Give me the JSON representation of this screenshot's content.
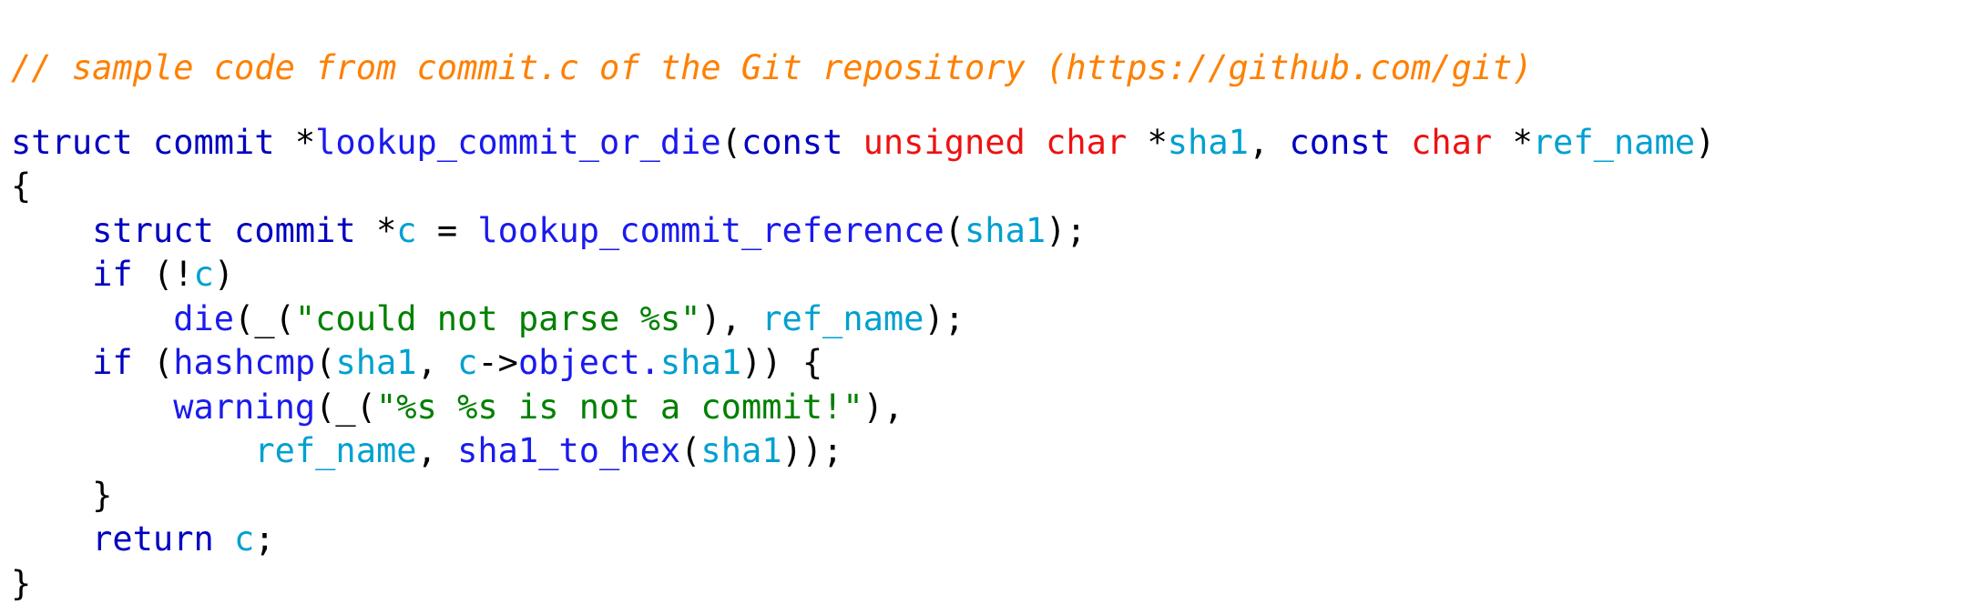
{
  "snippet": {
    "language": "C",
    "source_note": "// sample code from commit.c of the Git repository (https://github.com/git)",
    "background_color": "#ffffff",
    "palette": {
      "comment": "#ff8000",
      "keyword": "#0000c0",
      "type": "#ee1111",
      "function": "#1a1aee",
      "variable": "#00a0d0",
      "string": "#008000",
      "punctuation": "#000000"
    },
    "lines": [
      {
        "id": "line-1-comment",
        "tokens": [
          {
            "t": "// sample code from commit.c of the Git repository (https://github.com/git)",
            "c": "comment"
          }
        ]
      },
      {
        "id": "line-2-blank",
        "blank": true,
        "tokens": []
      },
      {
        "id": "line-3-signature",
        "tokens": [
          {
            "t": "struct commit ",
            "c": "keyword"
          },
          {
            "t": "*",
            "c": "punct"
          },
          {
            "t": "lookup_commit_or_die",
            "c": "function"
          },
          {
            "t": "(",
            "c": "punct"
          },
          {
            "t": "const ",
            "c": "keyword"
          },
          {
            "t": "unsigned char ",
            "c": "type"
          },
          {
            "t": "*",
            "c": "punct"
          },
          {
            "t": "sha1",
            "c": "variable"
          },
          {
            "t": ", ",
            "c": "punct"
          },
          {
            "t": "const ",
            "c": "keyword"
          },
          {
            "t": "char ",
            "c": "type"
          },
          {
            "t": "*",
            "c": "punct"
          },
          {
            "t": "ref_name",
            "c": "variable"
          },
          {
            "t": ")",
            "c": "punct"
          }
        ]
      },
      {
        "id": "line-4-open-brace",
        "tokens": [
          {
            "t": "{",
            "c": "punct"
          }
        ]
      },
      {
        "id": "line-5-declaration",
        "tokens": [
          {
            "t": "    ",
            "c": "plain"
          },
          {
            "t": "struct commit ",
            "c": "keyword"
          },
          {
            "t": "*",
            "c": "punct"
          },
          {
            "t": "c",
            "c": "variable"
          },
          {
            "t": " = ",
            "c": "punct"
          },
          {
            "t": "lookup_commit_reference",
            "c": "function"
          },
          {
            "t": "(",
            "c": "punct"
          },
          {
            "t": "sha1",
            "c": "variable"
          },
          {
            "t": ");",
            "c": "punct"
          }
        ]
      },
      {
        "id": "line-6-if-null",
        "tokens": [
          {
            "t": "    ",
            "c": "plain"
          },
          {
            "t": "if",
            "c": "keyword"
          },
          {
            "t": " (!",
            "c": "punct"
          },
          {
            "t": "c",
            "c": "variable"
          },
          {
            "t": ")",
            "c": "punct"
          }
        ]
      },
      {
        "id": "line-7-die",
        "tokens": [
          {
            "t": "        ",
            "c": "plain"
          },
          {
            "t": "die",
            "c": "function"
          },
          {
            "t": "(_(",
            "c": "punct"
          },
          {
            "t": "\"could not parse %s\"",
            "c": "string"
          },
          {
            "t": "), ",
            "c": "punct"
          },
          {
            "t": "ref_name",
            "c": "variable"
          },
          {
            "t": ");",
            "c": "punct"
          }
        ]
      },
      {
        "id": "line-8-if-hashcmp",
        "tokens": [
          {
            "t": "    ",
            "c": "plain"
          },
          {
            "t": "if",
            "c": "keyword"
          },
          {
            "t": " (",
            "c": "punct"
          },
          {
            "t": "hashcmp",
            "c": "function"
          },
          {
            "t": "(",
            "c": "punct"
          },
          {
            "t": "sha1",
            "c": "variable"
          },
          {
            "t": ", ",
            "c": "punct"
          },
          {
            "t": "c",
            "c": "variable"
          },
          {
            "t": "->",
            "c": "punct"
          },
          {
            "t": "object.",
            "c": "function"
          },
          {
            "t": "sha1",
            "c": "variable"
          },
          {
            "t": ")) {",
            "c": "punct"
          }
        ]
      },
      {
        "id": "line-9-warning",
        "tokens": [
          {
            "t": "        ",
            "c": "plain"
          },
          {
            "t": "warning",
            "c": "function"
          },
          {
            "t": "(_(",
            "c": "punct"
          },
          {
            "t": "\"%s %s is not a commit!\"",
            "c": "string"
          },
          {
            "t": "),",
            "c": "punct"
          }
        ]
      },
      {
        "id": "line-10-warning-args",
        "tokens": [
          {
            "t": "            ",
            "c": "plain"
          },
          {
            "t": "ref_name",
            "c": "variable"
          },
          {
            "t": ", ",
            "c": "punct"
          },
          {
            "t": "sha1_to_hex",
            "c": "function"
          },
          {
            "t": "(",
            "c": "punct"
          },
          {
            "t": "sha1",
            "c": "variable"
          },
          {
            "t": "));",
            "c": "punct"
          }
        ]
      },
      {
        "id": "line-11-close-if",
        "tokens": [
          {
            "t": "    ",
            "c": "plain"
          },
          {
            "t": "}",
            "c": "punct"
          }
        ]
      },
      {
        "id": "line-12-return",
        "tokens": [
          {
            "t": "    ",
            "c": "plain"
          },
          {
            "t": "return",
            "c": "keyword"
          },
          {
            "t": " ",
            "c": "punct"
          },
          {
            "t": "c",
            "c": "variable"
          },
          {
            "t": ";",
            "c": "punct"
          }
        ]
      },
      {
        "id": "line-13-close-brace",
        "tokens": [
          {
            "t": "}",
            "c": "punct"
          }
        ]
      }
    ]
  }
}
